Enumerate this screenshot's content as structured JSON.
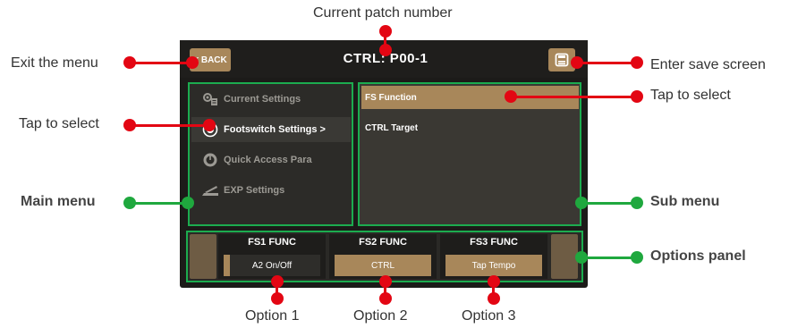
{
  "callouts": {
    "patch_number": "Current patch number",
    "exit_menu": "Exit the menu",
    "enter_save": "Enter save screen",
    "tap_select_left": "Tap to select",
    "tap_select_right": "Tap to select",
    "main_menu": "Main menu",
    "sub_menu": "Sub menu",
    "options_panel": "Options panel",
    "option1": "Option 1",
    "option2": "Option 2",
    "option3": "Option 3"
  },
  "header": {
    "back_label": "< BACK",
    "patch_title": "CTRL:  P00-1",
    "save_icon": "save-icon"
  },
  "main_menu": {
    "items": [
      {
        "label": "Current Settings",
        "icon": "current-settings-icon"
      },
      {
        "label": "Footswitch Settings >",
        "icon": "footswitch-icon",
        "active": true
      },
      {
        "label": "Quick Access Para",
        "icon": "quick-access-icon"
      },
      {
        "label": "EXP Settings",
        "icon": "exp-pedal-icon"
      }
    ]
  },
  "sub_menu": {
    "items": [
      {
        "label": "FS Function",
        "selected": true
      },
      {
        "label": "CTRL Target"
      }
    ]
  },
  "options": [
    {
      "label": "FS1 FUNC",
      "value": "A2 On/Off"
    },
    {
      "label": "FS2 FUNC",
      "value": "CTRL"
    },
    {
      "label": "FS3 FUNC",
      "value": "Tap Tempo"
    }
  ],
  "colors": {
    "accent": "#a8875a",
    "frame_green": "#1cac4f",
    "callout_red": "#e30613",
    "callout_green": "#1fa83e"
  }
}
